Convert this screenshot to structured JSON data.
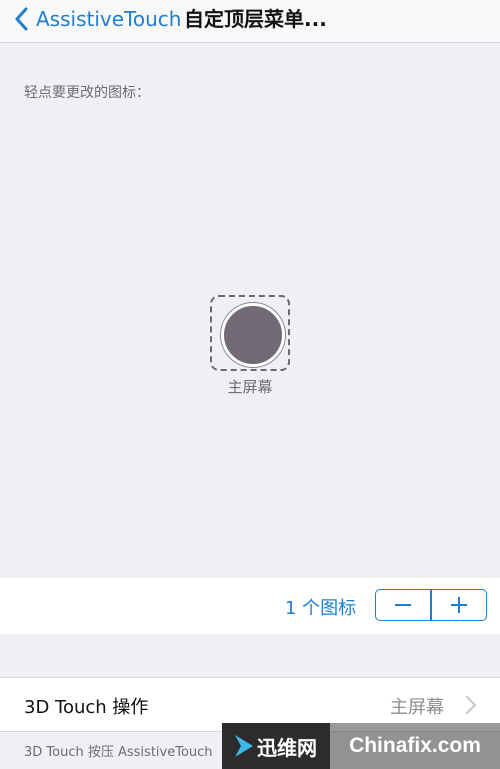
{
  "navbar": {
    "back_label": "AssistiveTouch",
    "title": "自定顶层菜单..."
  },
  "instruction": "轻点要更改的图标：",
  "icon": {
    "label": "主屏幕"
  },
  "count": {
    "label": "1 个图标",
    "minus_symbol": "−",
    "plus_symbol": "+"
  },
  "touch": {
    "label": "3D Touch 操作",
    "value": "主屏幕"
  },
  "footer": {
    "text": "3D Touch 按压 AssistiveTouch"
  },
  "watermark": {
    "brand": "迅维网",
    "domain": "Chinafix.com"
  },
  "colors": {
    "accent": "#1f7ed0",
    "background": "#efeff4",
    "home_button": "#706b74"
  },
  "icons": [
    "chevron-left-icon",
    "home-button-icon",
    "minus-icon",
    "plus-icon",
    "chevron-right-icon"
  ]
}
